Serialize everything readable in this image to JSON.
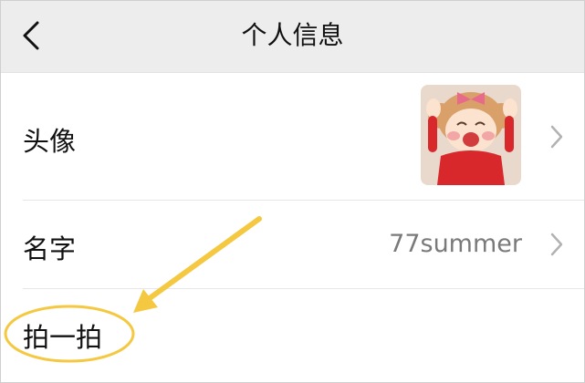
{
  "header": {
    "title": "个人信息",
    "back_icon": "chevron-left-icon"
  },
  "rows": [
    {
      "label": "头像",
      "value": "",
      "type": "avatar"
    },
    {
      "label": "名字",
      "value": "77summer",
      "type": "text"
    },
    {
      "label": "拍一拍",
      "value": "",
      "type": "text"
    }
  ],
  "annotation": {
    "color": "#f5c842",
    "target": "拍一拍"
  },
  "colors": {
    "nav_background": "#ededed",
    "text_primary": "#111111",
    "text_secondary": "#7a7a7a",
    "chevron": "#b2b2b2",
    "divider": "#e6e6e6"
  }
}
